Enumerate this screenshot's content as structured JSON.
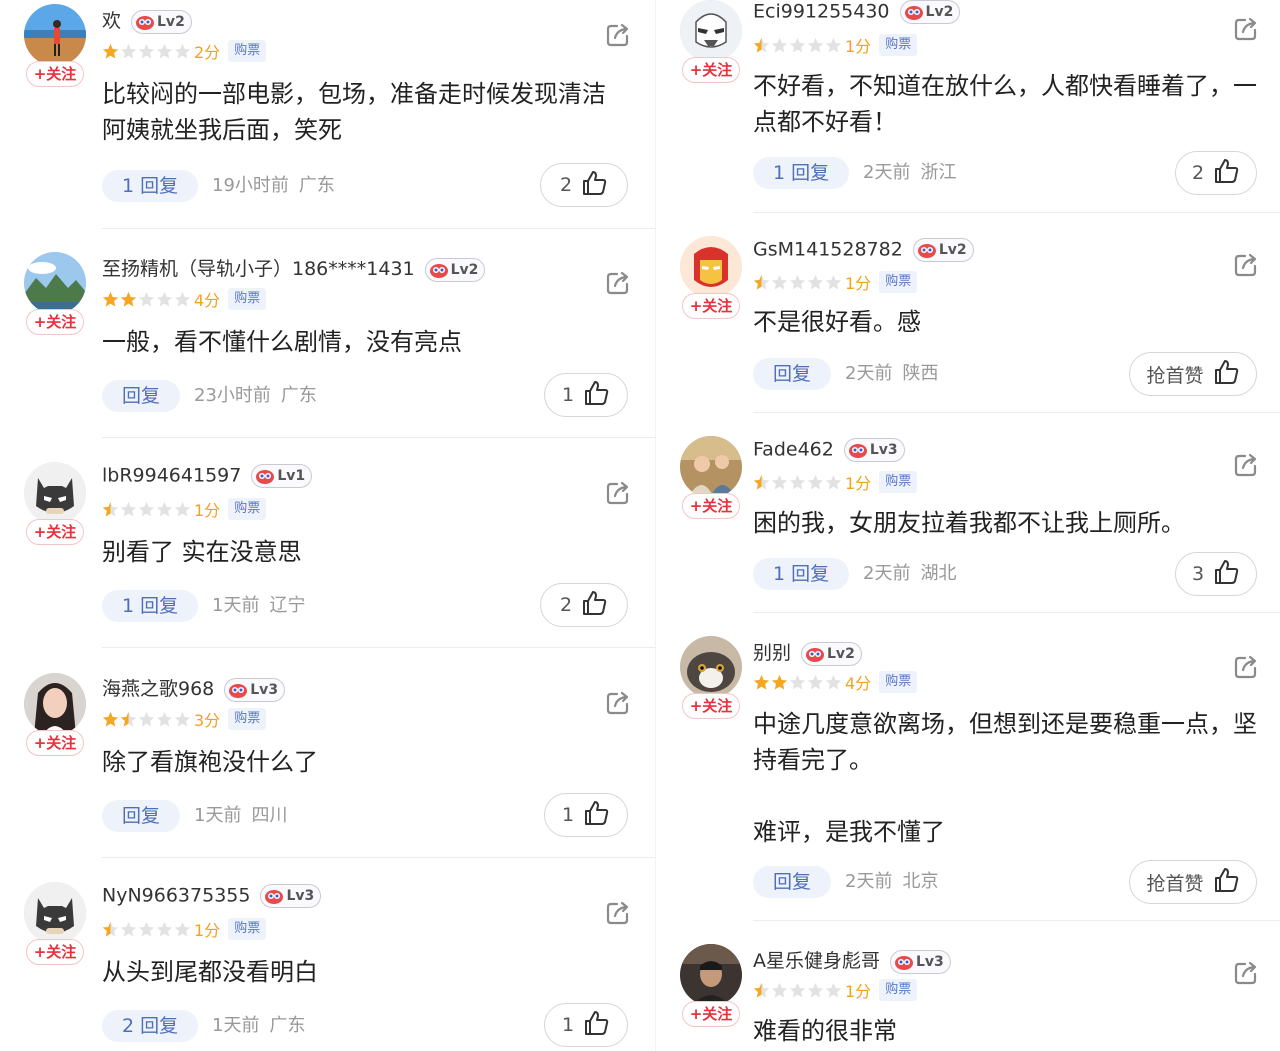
{
  "follow_label": "+关注",
  "buy_label": "购票",
  "left": [
    {
      "name": "欢",
      "level": "Lv2",
      "full_stars": 1,
      "half_star": false,
      "score": "2分",
      "text": "比较闷的一部电影，包场，准备走时候发现清洁\n阿姨就坐我后面，笑死",
      "reply": "1 回复",
      "time": "19小时前",
      "region": "广东",
      "like": "2"
    },
    {
      "name": "至扬精机（导轨小子）186****1431",
      "level": "Lv2",
      "full_stars": 2,
      "half_star": false,
      "score": "4分",
      "text": "一般，看不懂什么剧情，没有亮点",
      "reply": "回复",
      "time": "23小时前",
      "region": "广东",
      "like": "1"
    },
    {
      "name": "lbR994641597",
      "level": "Lv1",
      "full_stars": 0,
      "half_star": true,
      "score": "1分",
      "text": "别看了 实在没意思",
      "reply": "1 回复",
      "time": "1天前",
      "region": "辽宁",
      "like": "2"
    },
    {
      "name": "海燕之歌968",
      "level": "Lv3",
      "full_stars": 1,
      "half_star": true,
      "score": "3分",
      "text": "除了看旗袍没什么了",
      "reply": "回复",
      "time": "1天前",
      "region": "四川",
      "like": "1"
    },
    {
      "name": "NyN966375355",
      "level": "Lv3",
      "full_stars": 0,
      "half_star": true,
      "score": "1分",
      "text": "从头到尾都没看明白",
      "reply": "2 回复",
      "time": "1天前",
      "region": "广东",
      "like": "1"
    }
  ],
  "right": [
    {
      "name": "Eci991255430",
      "level": "Lv2",
      "full_stars": 0,
      "half_star": true,
      "score": "1分",
      "text": "不好看，不知道在放什么，人都快看睡着了，一\n点都不好看！",
      "reply": "1 回复",
      "time": "2天前",
      "region": "浙江",
      "like": "2"
    },
    {
      "name": "GsM141528782",
      "level": "Lv2",
      "full_stars": 0,
      "half_star": true,
      "score": "1分",
      "text": "不是很好看。感",
      "reply": "回复",
      "time": "2天前",
      "region": "陕西",
      "like": "抢首赞"
    },
    {
      "name": "Fade462",
      "level": "Lv3",
      "full_stars": 0,
      "half_star": true,
      "score": "1分",
      "text": "困的我，女朋友拉着我都不让我上厕所。",
      "reply": "1 回复",
      "time": "2天前",
      "region": "湖北",
      "like": "3"
    },
    {
      "name": "别别",
      "level": "Lv2",
      "full_stars": 2,
      "half_star": false,
      "score": "4分",
      "text": "中途几度意欲离场，但想到还是要稳重一点，坚\n持看完了。\n\n难评，是我不懂了",
      "reply": "回复",
      "time": "2天前",
      "region": "北京",
      "like": "抢首赞"
    },
    {
      "name": "A星乐健身彪哥",
      "level": "Lv3",
      "full_stars": 0,
      "half_star": true,
      "score": "1分",
      "text": "难看的很非常",
      "reply": "",
      "time": "",
      "region": "",
      "like": ""
    }
  ]
}
